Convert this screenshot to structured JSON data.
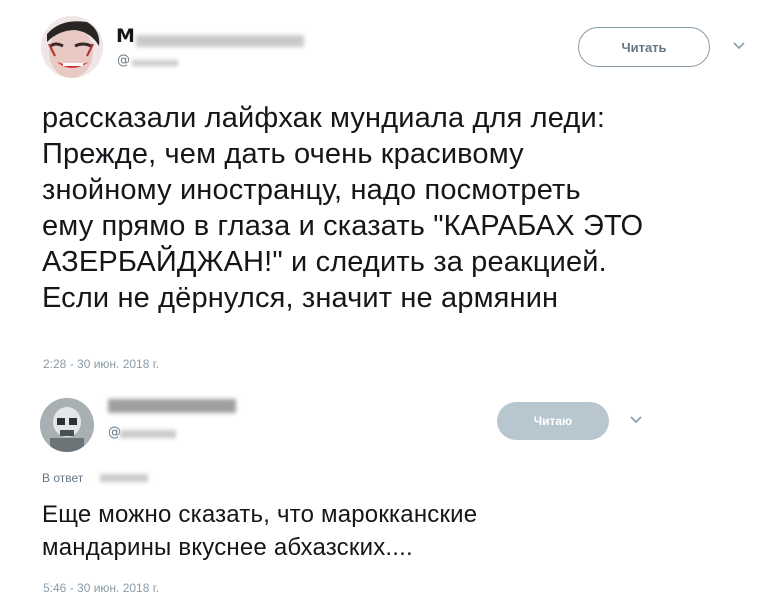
{
  "tweets": [
    {
      "name": "М",
      "handle": "@",
      "follow_label": "Читать",
      "text": "рассказали лайфхак мундиала для леди:\nПрежде, чем дать очень красивому\nзнойному иностранцу, надо посмотреть\nему прямо в глаза и сказать \"КАРАБАХ ЭТО\nАЗЕРБАЙДЖАН!\" и следить за реакцией.\nЕсли не дёрнулся, значит не армянин",
      "timestamp": "2:28 - 30 июн. 2018 г."
    },
    {
      "name": "",
      "handle": "@",
      "follow_label": "Читаю",
      "reply_to": "В ответ",
      "text": "Еще можно сказать,  что  марокканские\nмандарины вкуснее абхазских....",
      "timestamp": "5:46 - 30 июн. 2018 г."
    }
  ],
  "icons": {
    "chevron": "chevron-down-icon"
  }
}
